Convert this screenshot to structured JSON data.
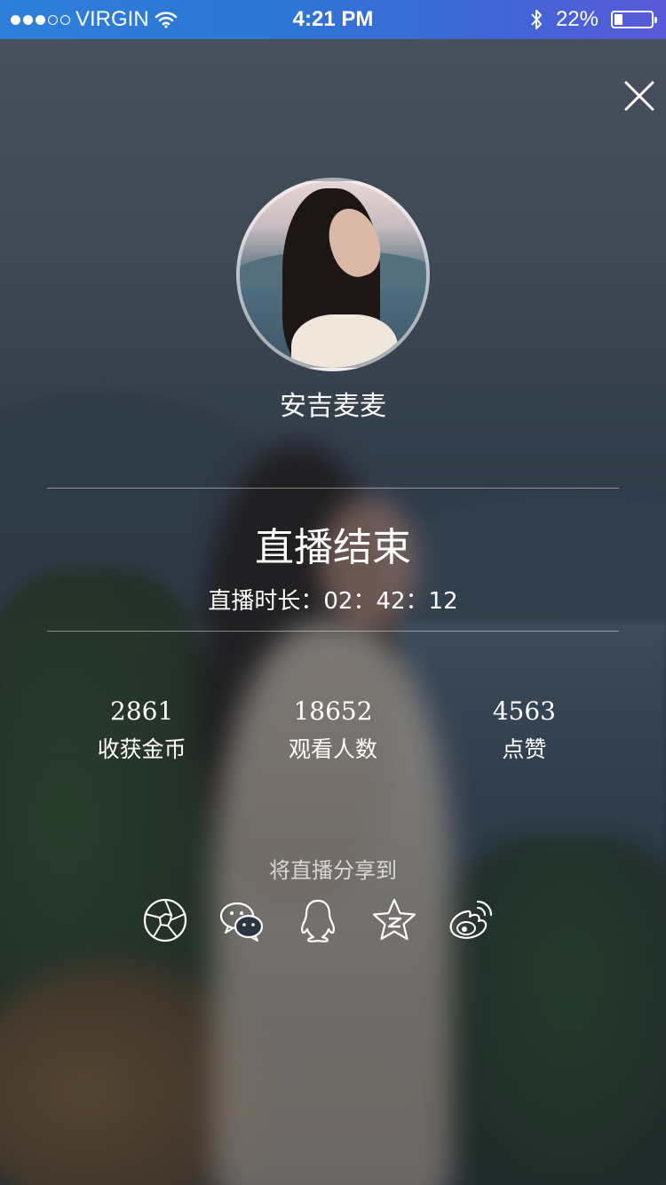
{
  "status_bar": {
    "carrier": "VIRGIN",
    "time": "4:21 PM",
    "battery_text": "22%",
    "battery_level": 0.22,
    "signal_bars_filled": 3,
    "signal_bars_total": 5
  },
  "profile": {
    "username": "安吉麦麦"
  },
  "summary": {
    "title": "直播结束",
    "duration_label": "直播时长：",
    "duration_value": "02：42：12"
  },
  "stats": [
    {
      "value": "2861",
      "label": "收获金币"
    },
    {
      "value": "18652",
      "label": "观看人数"
    },
    {
      "value": "4563",
      "label": "点赞"
    }
  ],
  "share": {
    "title": "将直播分享到",
    "targets": [
      {
        "icon": "moments-icon"
      },
      {
        "icon": "wechat-icon"
      },
      {
        "icon": "qq-icon"
      },
      {
        "icon": "qzone-icon"
      },
      {
        "icon": "weibo-icon"
      }
    ]
  },
  "colors": {
    "status_bar_start": "#2e7fd9",
    "status_bar_end": "#5a5ad8",
    "text": "#ffffff"
  }
}
